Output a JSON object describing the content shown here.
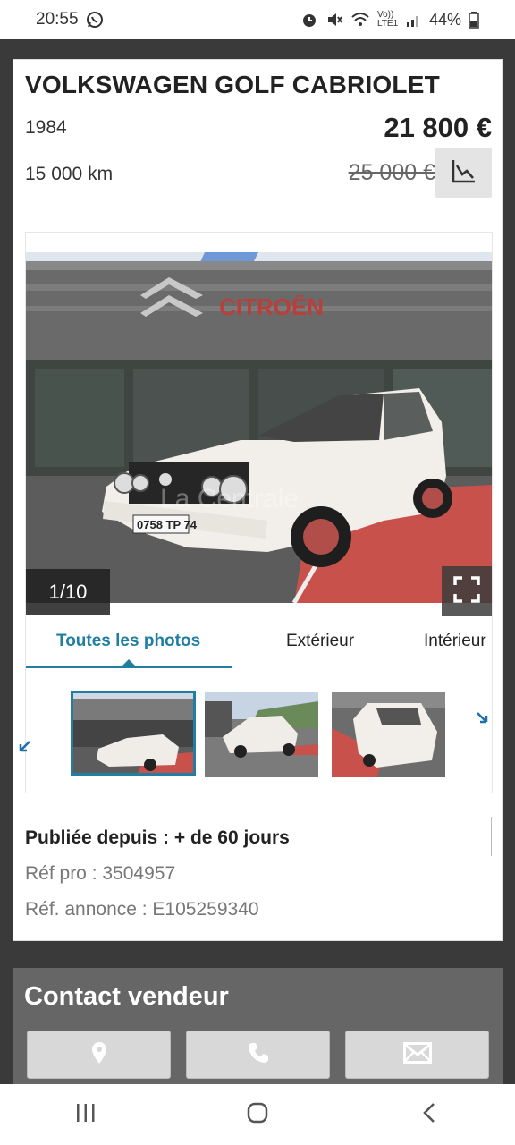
{
  "status_bar": {
    "time": "20:55",
    "battery": "44%",
    "network": "Vo)) LTE1"
  },
  "listing": {
    "title": "VOLKSWAGEN GOLF CABRIOLET",
    "year": "1984",
    "price": "21 800 €",
    "mileage": "15 000 km",
    "old_price": "25 000 €"
  },
  "gallery": {
    "counter": "1/10",
    "watermark": "La Centrale",
    "dealer_sign": "CITROËN",
    "plate": "0758 TP 74",
    "tabs": [
      {
        "label": "Toutes les photos",
        "active": true
      },
      {
        "label": "Extérieur",
        "active": false
      },
      {
        "label": "Intérieur",
        "active": false
      }
    ]
  },
  "info": {
    "published": "Publiée depuis : + de 60 jours",
    "pro_ref": "Réf pro : 3504957",
    "ad_ref": "Réf. annonce : E105259340"
  },
  "contact": {
    "title": "Contact vendeur"
  },
  "colors": {
    "accent": "#1f7ea1",
    "background": "#3a3a3a",
    "contact_bg": "#666666"
  },
  "icons": [
    "whatsapp-icon",
    "alarm-icon",
    "mute-icon",
    "wifi-icon",
    "signal-icon",
    "battery-icon",
    "price-chart-icon",
    "fullscreen-icon",
    "location-icon",
    "phone-icon",
    "mail-icon",
    "recent-apps-icon",
    "home-icon",
    "back-icon"
  ]
}
